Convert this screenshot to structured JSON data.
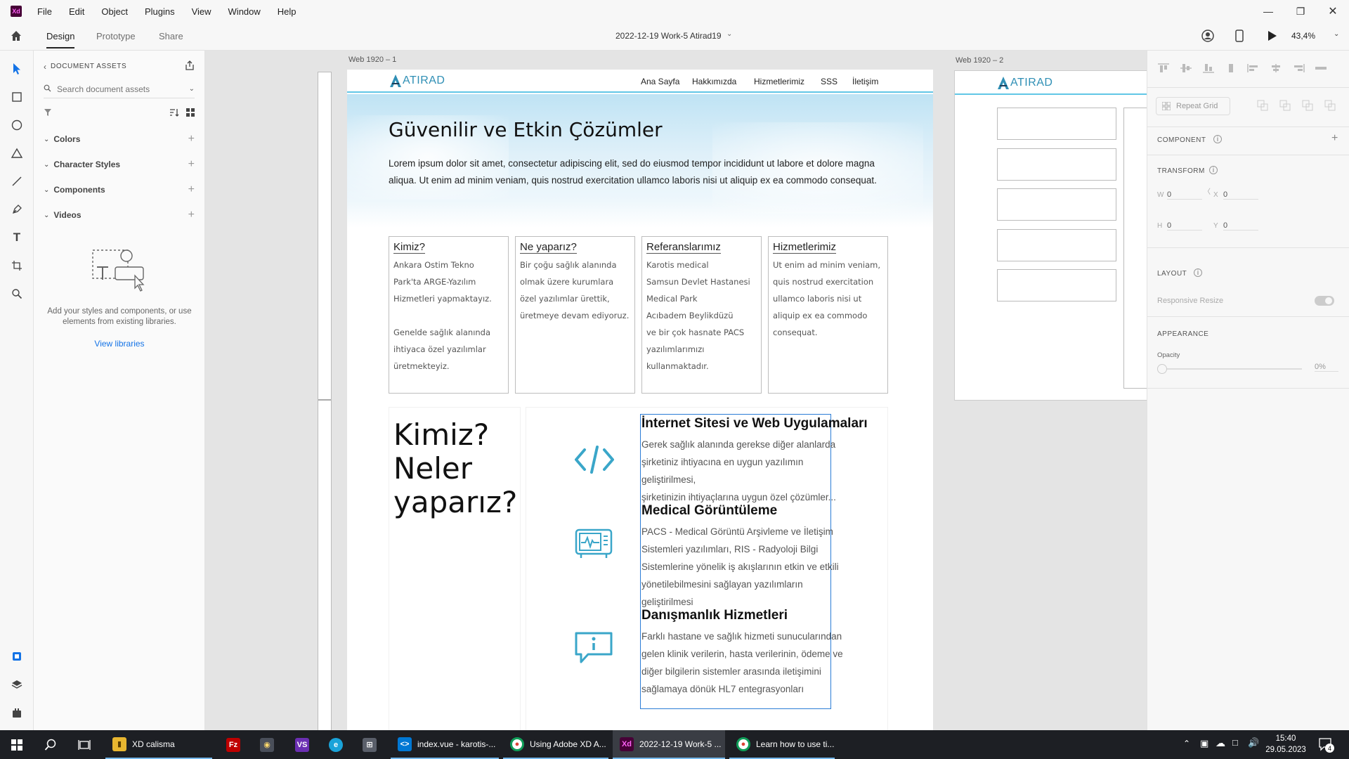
{
  "menubar": {
    "logo": "Xd",
    "items": [
      "File",
      "Edit",
      "Object",
      "Plugins",
      "View",
      "Window",
      "Help"
    ]
  },
  "toolbar": {
    "tabs": [
      "Design",
      "Prototype",
      "Share"
    ],
    "document_title": "2022-12-19 Work-5 Atirad19",
    "zoom": "43,4%"
  },
  "assets": {
    "header": "DOCUMENT ASSETS",
    "search_placeholder": "Search document assets",
    "sections": [
      "Colors",
      "Character Styles",
      "Components",
      "Videos"
    ],
    "empty_text": "Add your styles and components, or use elements from existing libraries.",
    "view_libraries": "View libraries"
  },
  "canvas": {
    "artboard1_label": "Web 1920 – 1",
    "artboard2_label": "Web 1920 – 2",
    "logo_text": "ATIRAD",
    "nav": [
      "Ana Sayfa",
      "Hakkımızda",
      "Hizmetlerimiz",
      "SSS",
      "İletişim"
    ],
    "hero_title": "Güvenilir ve Etkin Çözümler",
    "hero_text": "Lorem ipsum dolor sit amet, consectetur adipiscing elit, sed do eiusmod tempor incididunt ut labore et dolore magna aliqua. Ut enim ad minim veniam, quis nostrud exercitation ullamco laboris nisi ut aliquip ex ea commodo consequat.",
    "cards": [
      {
        "title": "Kimiz?",
        "body": "Ankara Ostim Tekno\nPark'ta ARGE-Yazılım\nHizmetleri yapmaktayız.\n\nGenelde sağlık alanında\nihtiyaca özel yazılımlar\nüretmekteyiz."
      },
      {
        "title": "Ne yaparız?",
        "body": "Bir çoğu sağlık alanında\nolmak üzere kurumlara\nözel yazılımlar ürettik,\nüretmeye devam ediyoruz."
      },
      {
        "title": "Referanslarımız",
        "body": "Karotis medical\nSamsun Devlet Hastanesi\nMedical Park\nAcıbadem Beylikdüzü\nve bir çok hasnate PACS\nyazılımlarımızı\nkullanmaktadır."
      },
      {
        "title": "Hizmetlerimiz",
        "body": "Ut enim ad minim veniam,\nquis nostrud exercitation\nullamco laboris nisi ut\naliquip ex ea commodo\nconsequat."
      }
    ],
    "big_heading": [
      "Kimiz?",
      "Neler",
      "yaparız?"
    ],
    "services": [
      {
        "title": "İnternet Sitesi ve Web Uygulamaları",
        "body": [
          "Gerek sağlık alanında gerekse diğer alanlarda",
          "şirketiniz ihtiyacına en uygun yazılımın geliştirilmesi,",
          "şirketinizin ihtiyaçlarına uygun özel çözümler..."
        ]
      },
      {
        "title": "Medical Görüntüleme",
        "body": [
          "PACS - Medical Görüntü Arşivleme ve İletişim",
          "Sistemleri yazılımları, RIS - Radyoloji Bilgi",
          "Sistemlerine yönelik iş akışlarının etkin ve etkili",
          "yönetilebilmesini sağlayan yazılımların geliştirilmesi"
        ]
      },
      {
        "title": "Danışmanlık Hizmetleri",
        "body": [
          "Farklı hastane ve sağlık hizmeti sunucularından",
          "gelen klinik verilerin, hasta verilerinin, ödeme ve",
          "diğer bilgilerin sistemler arasında iletişimini",
          "sağlamaya dönük HL7 entegrasyonları"
        ]
      }
    ]
  },
  "props": {
    "repeat_grid": "Repeat Grid",
    "component": "COMPONENT",
    "transform": "TRANSFORM",
    "w_label": "W",
    "w_value": "0",
    "x_label": "X",
    "x_value": "0",
    "h_label": "H",
    "h_value": "0",
    "y_label": "Y",
    "y_value": "0",
    "layout": "LAYOUT",
    "responsive_resize": "Responsive Resize",
    "appearance": "APPEARANCE",
    "opacity_label": "Opacity",
    "opacity_value": "0%"
  },
  "taskbar": {
    "items": [
      {
        "label": "XD calisma"
      },
      {
        "label": "index.vue - karotis-..."
      },
      {
        "label": "Using Adobe XD A..."
      },
      {
        "label": "2022-12-19 Work-5 ..."
      },
      {
        "label": "Learn how to use ti..."
      }
    ],
    "time": "15:40",
    "date": "29.05.2023",
    "notification_count": "4"
  },
  "colors": {
    "accent": "#2b7dd6",
    "xd_brand": "#470137",
    "icon_blue": "#3aa6c9",
    "link": "#1473e6"
  }
}
